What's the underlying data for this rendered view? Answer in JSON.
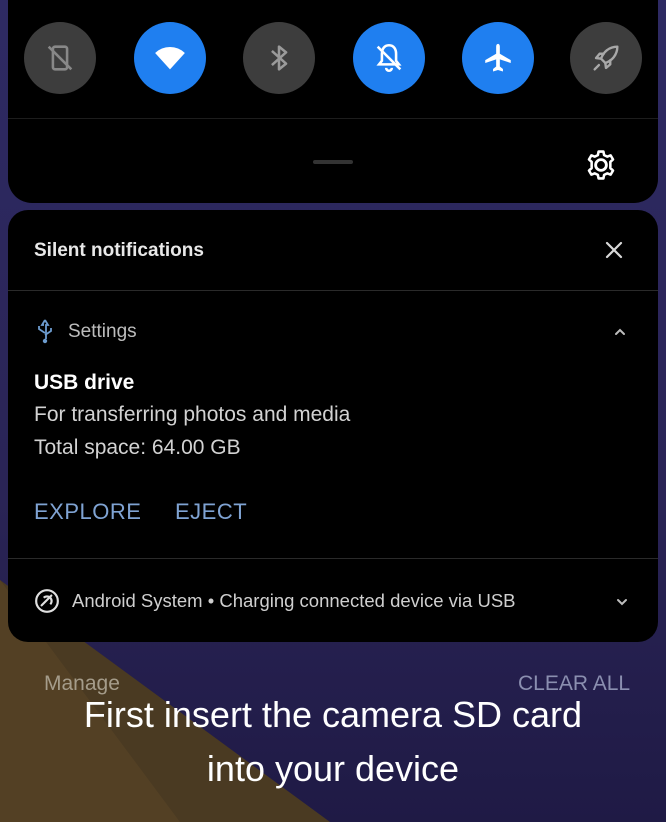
{
  "quick_settings": {
    "tiles": [
      {
        "icon": "auto-rotate-off-icon",
        "state": "off"
      },
      {
        "icon": "wifi-icon",
        "state": "on"
      },
      {
        "icon": "bluetooth-icon",
        "state": "off"
      },
      {
        "icon": "notifications-off-icon",
        "state": "on"
      },
      {
        "icon": "airplane-icon",
        "state": "on"
      },
      {
        "icon": "rocket-icon",
        "state": "off"
      }
    ],
    "settings_icon": "gear-icon"
  },
  "notifications": {
    "header": "Silent notifications",
    "usb": {
      "app_icon": "usb-icon",
      "app_name": "Settings",
      "title": "USB drive",
      "line1": "For transferring photos and media",
      "line2": "Total space: 64.00 GB",
      "actions": [
        "EXPLORE",
        "EJECT"
      ]
    },
    "system": {
      "icon": "android-system-icon",
      "text": "Android System • Charging connected device via USB"
    }
  },
  "footer": {
    "manage": "Manage",
    "clear_all": "CLEAR ALL"
  },
  "caption": {
    "line1": "First insert the camera SD card",
    "line2": "into your device"
  },
  "colors": {
    "tile_on": "#1f7ff0",
    "tile_off": "#3d3d3d",
    "action_text": "#7fa3d3",
    "background": "#2a2456"
  }
}
